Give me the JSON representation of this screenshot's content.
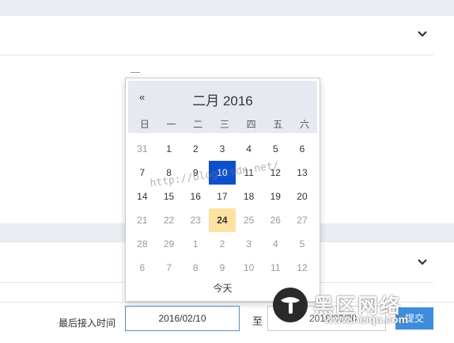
{
  "filter": {
    "last_access_label": "最后接入时间",
    "start_date": "2016/02/10",
    "to_label": "至",
    "end_date": "2016/02/20",
    "submit_label": "提交"
  },
  "datepicker": {
    "prev_label": "«",
    "title": "二月 2016",
    "weekdays": [
      "日",
      "一",
      "二",
      "三",
      "四",
      "五",
      "六"
    ],
    "weeks": [
      [
        {
          "d": "31",
          "m": true
        },
        {
          "d": "1"
        },
        {
          "d": "2"
        },
        {
          "d": "3"
        },
        {
          "d": "4"
        },
        {
          "d": "5"
        },
        {
          "d": "6"
        }
      ],
      [
        {
          "d": "7"
        },
        {
          "d": "8"
        },
        {
          "d": "9"
        },
        {
          "d": "10",
          "sel": true
        },
        {
          "d": "11"
        },
        {
          "d": "12"
        },
        {
          "d": "13"
        }
      ],
      [
        {
          "d": "14"
        },
        {
          "d": "15"
        },
        {
          "d": "16"
        },
        {
          "d": "17"
        },
        {
          "d": "18"
        },
        {
          "d": "19"
        },
        {
          "d": "20"
        }
      ],
      [
        {
          "d": "21",
          "m": true
        },
        {
          "d": "22",
          "m": true
        },
        {
          "d": "23",
          "m": true
        },
        {
          "d": "24",
          "today": true
        },
        {
          "d": "25",
          "m": true
        },
        {
          "d": "26",
          "m": true
        },
        {
          "d": "27",
          "m": true
        }
      ],
      [
        {
          "d": "28",
          "m": true
        },
        {
          "d": "29",
          "m": true
        },
        {
          "d": "1",
          "m": true
        },
        {
          "d": "2",
          "m": true
        },
        {
          "d": "3",
          "m": true
        },
        {
          "d": "4",
          "m": true
        },
        {
          "d": "5",
          "m": true
        }
      ],
      [
        {
          "d": "6",
          "m": true
        },
        {
          "d": "7",
          "m": true
        },
        {
          "d": "8",
          "m": true
        },
        {
          "d": "9",
          "m": true
        },
        {
          "d": "10",
          "m": true
        },
        {
          "d": "11",
          "m": true
        },
        {
          "d": "12",
          "m": true
        }
      ]
    ],
    "today_label": "今天",
    "selected_color": "#0b4fd1",
    "today_color": "#fde2a0"
  },
  "watermark": "http://blog.csdn.net/",
  "site_logo": {
    "name": "黑区网络",
    "url": "www.heiqu.com"
  }
}
